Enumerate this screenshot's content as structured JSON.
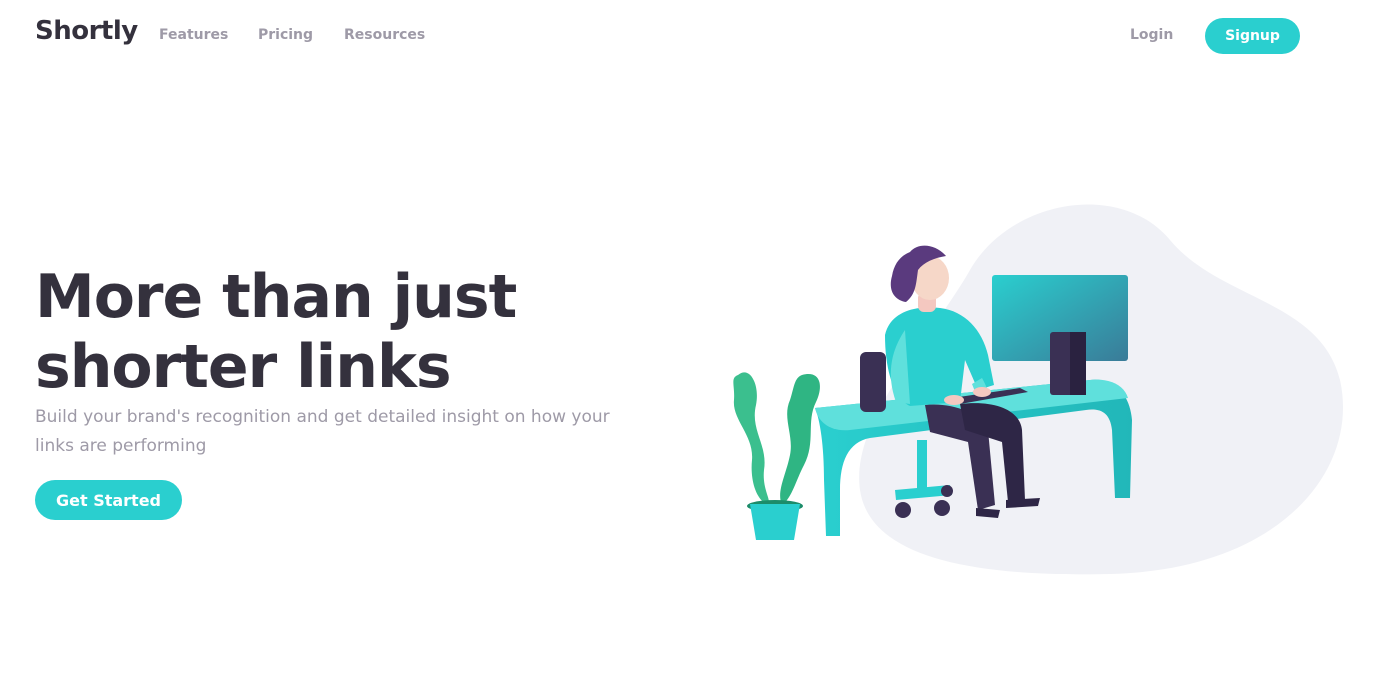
{
  "header": {
    "logo": "Shortly",
    "nav": {
      "features": "Features",
      "pricing": "Pricing",
      "resources": "Resources"
    },
    "login_label": "Login",
    "signup_label": "Signup"
  },
  "hero": {
    "title_line1": "More than just",
    "title_line2": "shorter links",
    "subtitle": "Build your brand's recognition and get detailed insight on how your links are performing",
    "cta_label": "Get Started"
  },
  "colors": {
    "accent": "#2acfcf",
    "heading": "#34313d",
    "muted": "#9e9aa7",
    "blob": "#f0f1f6"
  },
  "illustration": {
    "icon": "person-working-at-desk-illustration"
  }
}
